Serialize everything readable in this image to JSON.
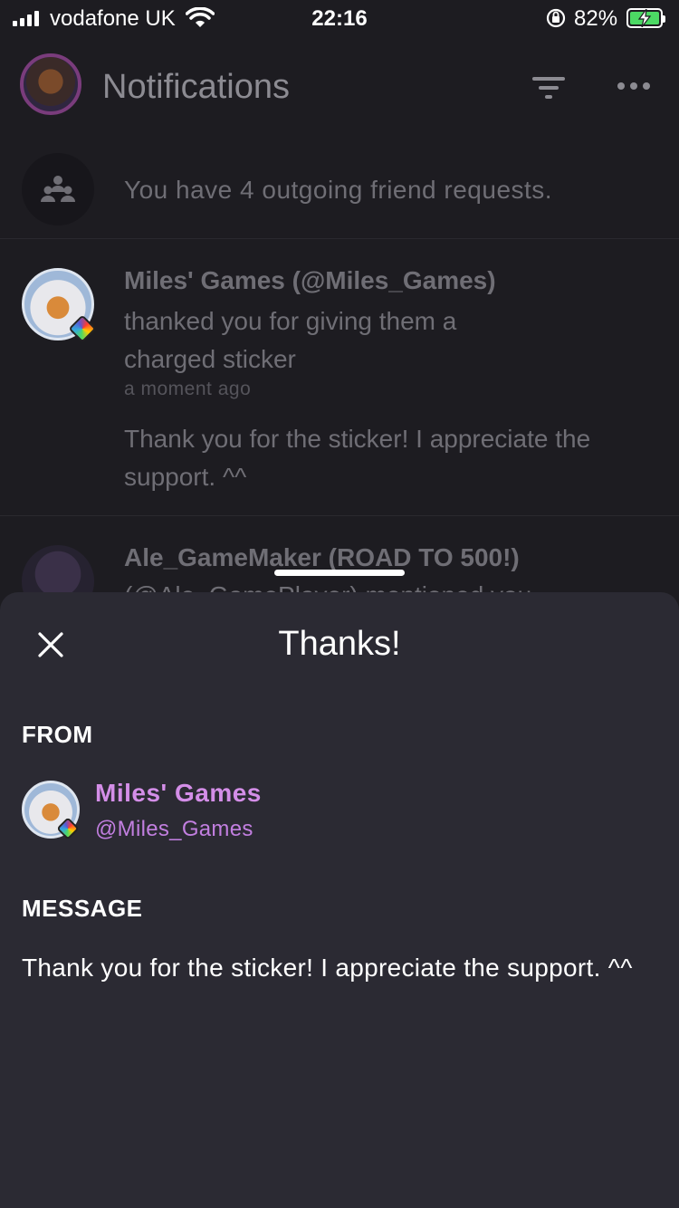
{
  "status_bar": {
    "carrier": "vodafone UK",
    "time": "22:16",
    "battery_percent": "82%",
    "battery_level": 0.82
  },
  "header": {
    "title": "Notifications",
    "icons": [
      "filter-icon",
      "more-icon"
    ]
  },
  "friend_requests": {
    "text": "You have 4 outgoing friend requests."
  },
  "notifications": [
    {
      "name": "Miles' Games (@Miles_Games)",
      "action": "thanked you for giving them a charged sticker",
      "time": "a moment ago",
      "message": "Thank you for the sticker! I appreciate the support. ^^"
    },
    {
      "name": "Ale_GameMaker (ROAD TO 500!)",
      "line2": "(@Ale_GamePlayer) mentioned you"
    }
  ],
  "sheet": {
    "title": "Thanks!",
    "from_label": "FROM",
    "from_name": "Miles' Games",
    "from_handle": "@Miles_Games",
    "message_label": "MESSAGE",
    "message": "Thank you for the sticker! I appreciate the support. ^^"
  },
  "colors": {
    "background": "#1d1c21",
    "sheet_background": "#2b2a33",
    "accent_name": "#d48ee8",
    "dim_text": "#6f6e75"
  }
}
